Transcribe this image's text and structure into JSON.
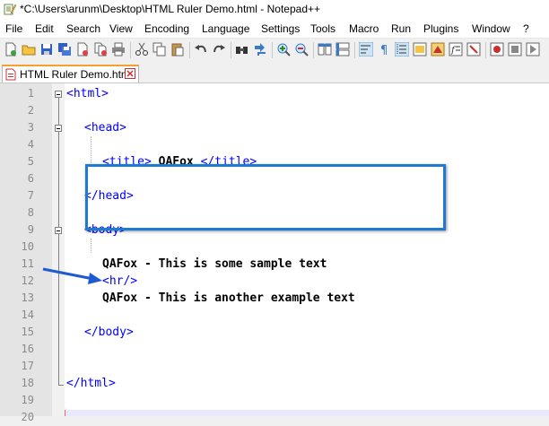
{
  "window": {
    "title": "*C:\\Users\\arunm\\Desktop\\HTML Ruler Demo.html - Notepad++"
  },
  "menu": [
    "File",
    "Edit",
    "Search",
    "View",
    "Encoding",
    "Language",
    "Settings",
    "Tools",
    "Macro",
    "Run",
    "Plugins",
    "Window",
    "?"
  ],
  "tab": {
    "label": "HTML Ruler Demo.html"
  },
  "line_numbers": [
    "1",
    "2",
    "3",
    "4",
    "5",
    "6",
    "7",
    "8",
    "9",
    "10",
    "11",
    "12",
    "13",
    "14",
    "15",
    "16",
    "17",
    "18",
    "19",
    "20"
  ],
  "code": {
    "l1": "<html>",
    "l3": "<head>",
    "l5_open": "<title>",
    "l5_text": " QAFox ",
    "l5_close": "</title>",
    "l7": "</head>",
    "l9": "<body>",
    "l11": "QAFox - This is some sample text",
    "l12": "<hr/>",
    "l13": "QAFox - This is another example text",
    "l15": "</body>",
    "l18": "</html>"
  },
  "colors": {
    "tag": "#0000ff",
    "highlight_box": "#1e7bd2",
    "tab_accent": "#f5a030"
  },
  "icons": {
    "toolbar": [
      "new-file",
      "open-file",
      "save",
      "save-all",
      "close",
      "close-all",
      "print",
      "cut",
      "copy",
      "paste",
      "undo",
      "redo",
      "find",
      "replace",
      "zoom-in",
      "zoom-out",
      "sync-vertical",
      "sync-horizontal",
      "word-wrap",
      "show-all-characters",
      "indent-guide",
      "user-defined-language",
      "doc-map",
      "function-list",
      "folder-as-workspace"
    ]
  }
}
